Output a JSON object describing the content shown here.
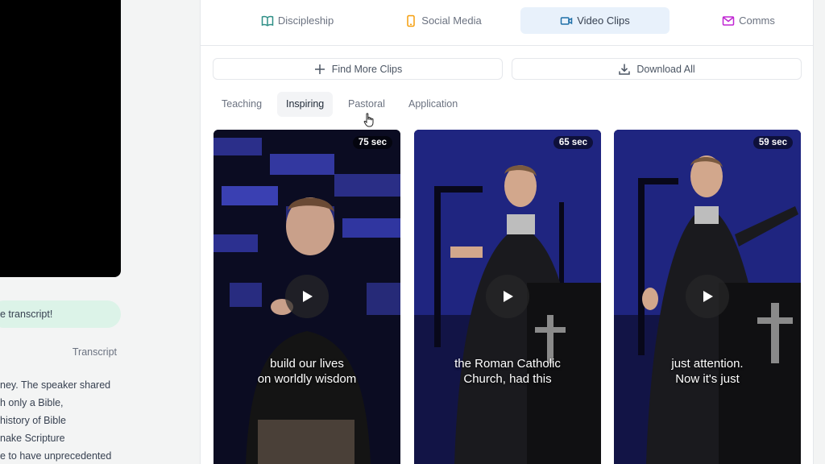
{
  "left": {
    "toast_text": "e transcript!",
    "transcript_label": "Transcript",
    "transcript_lines": [
      "ney. The speaker shared",
      "h only a Bible,",
      "history of Bible",
      "nake Scripture",
      "e to have unprecedented"
    ]
  },
  "top_tabs": [
    {
      "label": "Discipleship",
      "icon": "book-icon"
    },
    {
      "label": "Social Media",
      "icon": "phone-icon"
    },
    {
      "label": "Video Clips",
      "icon": "video-camera-icon"
    },
    {
      "label": "Comms",
      "icon": "mail-icon"
    }
  ],
  "actions": {
    "find_more": "Find More Clips",
    "download_all": "Download All"
  },
  "sub_tabs": [
    "Teaching",
    "Inspiring",
    "Pastoral",
    "Application"
  ],
  "clips": [
    {
      "duration": "75 sec",
      "caption_lines": [
        "build our lives",
        "on worldly wisdom"
      ]
    },
    {
      "duration": "65 sec",
      "caption_lines": [
        "the Roman Catholic",
        "Church, had this"
      ]
    },
    {
      "duration": "59 sec",
      "caption_lines": [
        "just attention.",
        "Now it's just"
      ]
    }
  ],
  "colors": {
    "active_tab_bg": "#e8f1fb",
    "toast_bg": "#dcf3e8",
    "discipleship_icon": "#2f8f86",
    "social_icon": "#f59e0b",
    "video_icon": "#1e6fa8",
    "comms_icon": "#c026d3"
  }
}
